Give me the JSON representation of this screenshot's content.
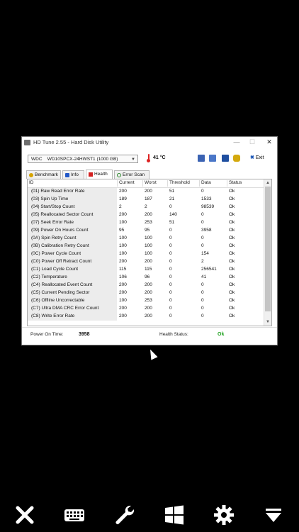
{
  "window": {
    "title": "HD Tune 2.55 - Hard Disk Utility",
    "controls": {
      "minimize": "—",
      "maximize": "☐",
      "close": "✕"
    }
  },
  "toolbar": {
    "drive": "WDC    WD10SPCX-24HWST1 (1000 GB)",
    "temperature": "41 °C",
    "exit_label": "Exit",
    "icons": [
      "copy-info-icon",
      "copy-screen-icon",
      "save-icon",
      "options-icon"
    ]
  },
  "tabs": [
    "Benchmark",
    "Info",
    "Health",
    "Error Scan"
  ],
  "active_tab": "Health",
  "table": {
    "columns": [
      "ID",
      "Current",
      "Worst",
      "Threshold",
      "Data",
      "Status"
    ],
    "rows": [
      [
        "(01) Raw Read Error Rate",
        "200",
        "200",
        "51",
        "0",
        "Ok"
      ],
      [
        "(03) Spin Up Time",
        "189",
        "187",
        "21",
        "1533",
        "Ok"
      ],
      [
        "(04) Start/Stop Count",
        "2",
        "2",
        "0",
        "98539",
        "Ok"
      ],
      [
        "(05) Reallocated Sector Count",
        "200",
        "200",
        "140",
        "0",
        "Ok"
      ],
      [
        "(07) Seek Error Rate",
        "100",
        "253",
        "51",
        "0",
        "Ok"
      ],
      [
        "(09) Power On Hours Count",
        "95",
        "95",
        "0",
        "3958",
        "Ok"
      ],
      [
        "(0A) Spin Retry Count",
        "100",
        "100",
        "0",
        "0",
        "Ok"
      ],
      [
        "(0B) Calibration Retry Count",
        "100",
        "100",
        "0",
        "0",
        "Ok"
      ],
      [
        "(0C) Power Cycle Count",
        "100",
        "100",
        "0",
        "154",
        "Ok"
      ],
      [
        "(C0) Power Off Retract Count",
        "200",
        "200",
        "0",
        "2",
        "Ok"
      ],
      [
        "(C1) Load Cycle Count",
        "115",
        "115",
        "0",
        "256541",
        "Ok"
      ],
      [
        "(C2) Temperature",
        "106",
        "96",
        "0",
        "41",
        "Ok"
      ],
      [
        "(C4) Reallocated Event Count",
        "200",
        "200",
        "0",
        "0",
        "Ok"
      ],
      [
        "(C5) Current Pending Sector",
        "200",
        "200",
        "0",
        "0",
        "Ok"
      ],
      [
        "(C6) Offline Uncorrectable",
        "100",
        "253",
        "0",
        "0",
        "Ok"
      ],
      [
        "(C7) Ultra DMA CRC Error Count",
        "200",
        "200",
        "0",
        "0",
        "Ok"
      ],
      [
        "(C8) Write Error Rate",
        "200",
        "200",
        "0",
        "0",
        "Ok"
      ]
    ]
  },
  "status": {
    "power_on_label": "Power On Time:",
    "power_on_value": "3958",
    "health_label": "Health Status:",
    "health_value": "Ok",
    "health_color": "#22a322"
  },
  "bottom_bar": [
    "close-icon",
    "keyboard-icon",
    "wrench-icon",
    "windows-icon",
    "gear-icon",
    "dropdown-icon"
  ]
}
